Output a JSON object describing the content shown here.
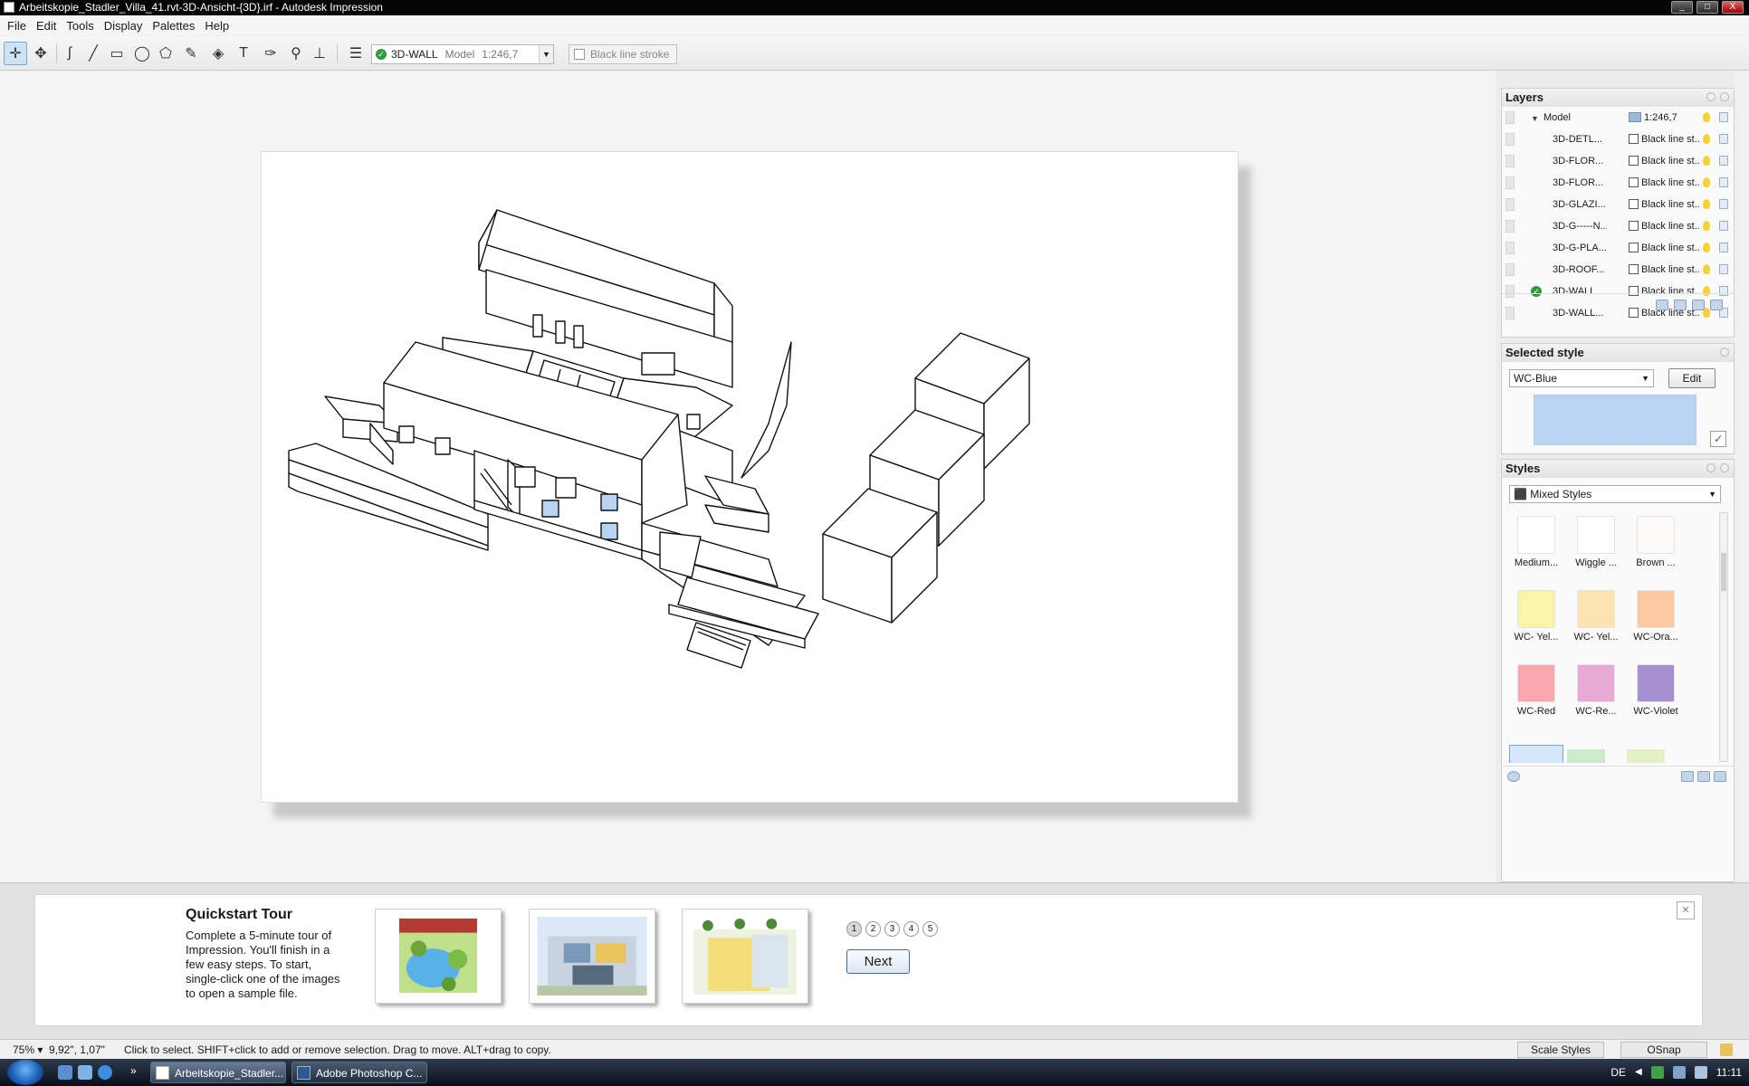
{
  "window": {
    "title": "Arbeitskopie_Stadler_Villa_41.rvt-3D-Ansicht-{3D}.irf - Autodesk Impression",
    "controls": [
      "_",
      "□",
      "X"
    ]
  },
  "menu": [
    "File",
    "Edit",
    "Tools",
    "Display",
    "Palettes",
    "Help"
  ],
  "toolbar": {
    "tools": [
      "select-icon",
      "direct-select-icon",
      "freehand-icon",
      "line-icon",
      "rectangle-icon",
      "ellipse-icon",
      "polygon-icon",
      "pen-icon",
      "fill-icon",
      "text-icon",
      "eyedropper-icon",
      "zoom-icon",
      "stamp-icon"
    ],
    "active_layer": "3D-WALL",
    "layer_group": "Model",
    "scale": "1:246,7",
    "stroke": "Black line stroke"
  },
  "layers_panel": {
    "title": "Layers",
    "model_row": {
      "name": "Model",
      "scale": "1:246,7"
    },
    "rows": [
      {
        "name": "3D-DETL...",
        "style": "Black line st..",
        "active": false
      },
      {
        "name": "3D-FLOR...",
        "style": "Black line st..",
        "active": false
      },
      {
        "name": "3D-FLOR...",
        "style": "Black line st..",
        "active": false
      },
      {
        "name": "3D-GLAZI...",
        "style": "Black line st..",
        "active": false
      },
      {
        "name": "3D-G-----N...",
        "style": "Black line st..",
        "active": false
      },
      {
        "name": "3D-G-PLA...",
        "style": "Black line st..",
        "active": false
      },
      {
        "name": "3D-ROOF...",
        "style": "Black line st..",
        "active": false
      },
      {
        "name": "3D-WALL",
        "style": "Black line st..",
        "active": true
      },
      {
        "name": "3D-WALL...",
        "style": "Black line st..",
        "active": false
      }
    ]
  },
  "selected_style_panel": {
    "title": "Selected style",
    "style_name": "WC-Blue",
    "edit_label": "Edit",
    "preview_color": "#b9d3f3"
  },
  "styles_panel": {
    "title": "Styles",
    "filter": "Mixed Styles",
    "items": [
      {
        "label": "Medium...",
        "color": "#ffffff"
      },
      {
        "label": "Wiggle ...",
        "color": "#ffffff"
      },
      {
        "label": "Brown ...",
        "color": "#fffafa"
      },
      {
        "label": "WC- Yel...",
        "color": "#fbf4a8"
      },
      {
        "label": "WC- Yel...",
        "color": "#fde3b0"
      },
      {
        "label": "WC-Ora...",
        "color": "#fcc9a2"
      },
      {
        "label": "WC-Red",
        "color": "#f9a7b0"
      },
      {
        "label": "WC-Re...",
        "color": "#e7a8d3"
      },
      {
        "label": "WC-Violet",
        "color": "#a78fd3"
      }
    ]
  },
  "tour": {
    "title": "Quickstart Tour",
    "description": "Complete a 5-minute tour of Impression. You'll finish in a few easy steps. To start, single-click one of the images to open a sample file.",
    "pages": [
      "1",
      "2",
      "3",
      "4",
      "5"
    ],
    "current_page": "1",
    "next_label": "Next",
    "close_label": "×"
  },
  "status": {
    "zoom": "75%",
    "coords": "9,92\", 1,07\"",
    "hint": "Click to select. SHIFT+click to add or remove selection. Drag to move. ALT+drag to copy.",
    "scale_styles": "Scale Styles",
    "osnap": "OSnap"
  },
  "taskbar": {
    "tasks": [
      "Arbeitskopie_Stadler...",
      "Adobe Photoshop C..."
    ],
    "lang": "DE",
    "time": "11:11"
  }
}
